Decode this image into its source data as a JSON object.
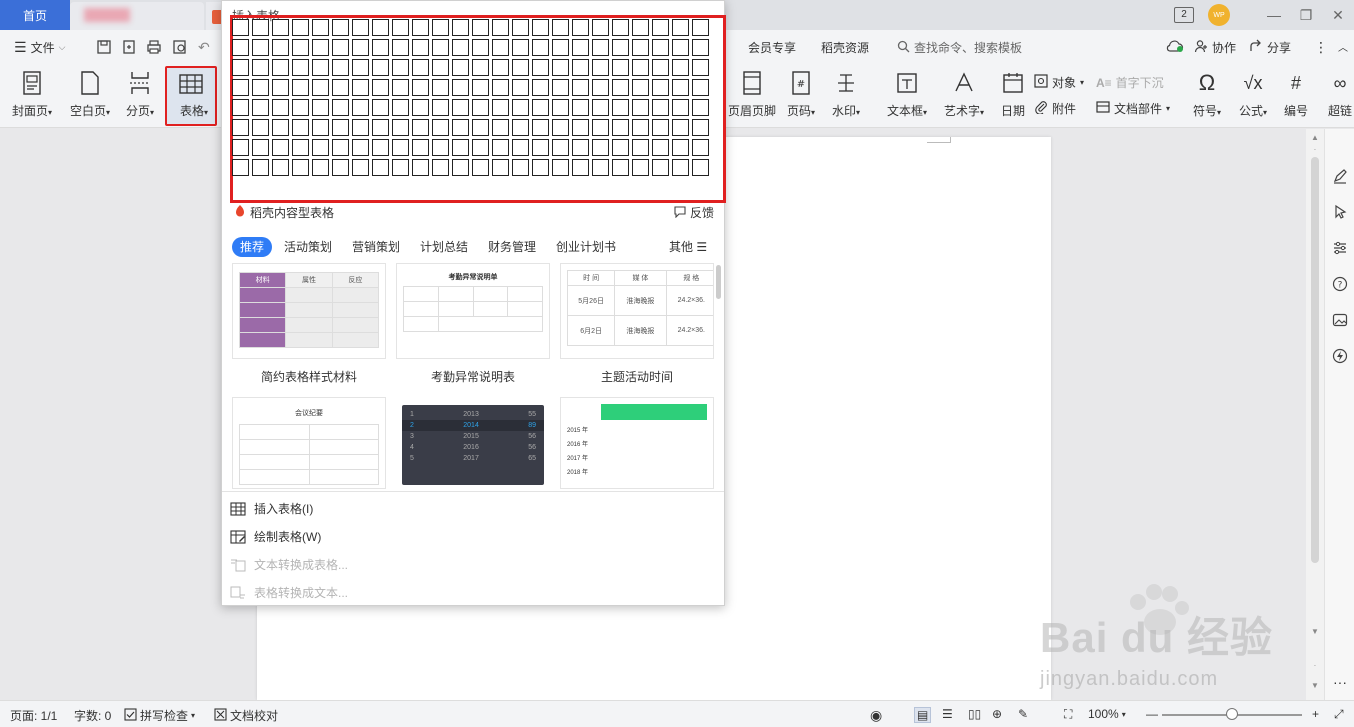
{
  "titlebar": {
    "home_tab": "首页",
    "badge": "2",
    "avatar": "WP"
  },
  "menu": {
    "file": "文件",
    "member": "会员专享",
    "resources": "稻壳资源",
    "search_placeholder": "查找命令、搜索模板",
    "collab": "协作",
    "share": "分享"
  },
  "ribbon": {
    "cover": "封面页",
    "blank": "空白页",
    "pagebreak": "分页",
    "table": "表格",
    "header_footer": "页眉页脚",
    "page_number": "页码",
    "watermark": "水印",
    "textbox": "文本框",
    "wordart": "艺术字",
    "date": "日期",
    "object": "对象",
    "dropcap": "首字下沉",
    "attachment": "附件",
    "docpart": "文档部件",
    "symbol": "符号",
    "formula": "公式",
    "numbering": "编号",
    "hyperlink": "超链"
  },
  "dropdown": {
    "title": "插入表格",
    "grid_rows": 8,
    "grid_cols": 24,
    "brand": "稻壳内容型表格",
    "feedback": "反馈",
    "categories": [
      "推荐",
      "活动策划",
      "营销策划",
      "计划总结",
      "财务管理",
      "创业计划书"
    ],
    "more": "其他",
    "templates": [
      {
        "name": "简约表格样式材料",
        "headers": [
          "材料",
          "属性",
          "反应"
        ]
      },
      {
        "name": "考勤异常说明表",
        "heading": "考勤异常说明单"
      },
      {
        "name": "主题活动时间",
        "headers": [
          "时 间",
          "媒 体",
          "规 格"
        ],
        "rows": [
          [
            "5月26日",
            "淮海晚报",
            "24.2×36."
          ],
          [
            "6月2日",
            "淮海晚报",
            "24.2×36."
          ]
        ]
      },
      {
        "heading": "会议纪要"
      },
      {
        "rows": [
          [
            "1",
            "2013",
            "55"
          ],
          [
            "2",
            "2014",
            "89"
          ],
          [
            "3",
            "2015",
            "56"
          ],
          [
            "4",
            "2016",
            "56"
          ],
          [
            "5",
            "2017",
            "65"
          ]
        ]
      },
      {
        "rows": [
          "2015 年",
          "2016 年",
          "2017 年",
          "2018 年"
        ]
      }
    ],
    "actions": {
      "insert_table": "插入表格(I)",
      "draw_table": "绘制表格(W)",
      "text_to_table": "文本转换成表格...",
      "table_to_text": "表格转换成文本..."
    }
  },
  "status": {
    "page": "页面: 1/1",
    "words": "字数: 0",
    "spell": "拼写检查",
    "proof": "文档校对",
    "zoom": "100%"
  },
  "watermark": {
    "text": "Bai du 经验",
    "sub": "jingyan.baidu.com"
  },
  "colors": {
    "accent": "#2f7cf6",
    "home_tab": "#3b6fd8",
    "highlight": "#e02020",
    "purple": "#9b6aa8"
  }
}
